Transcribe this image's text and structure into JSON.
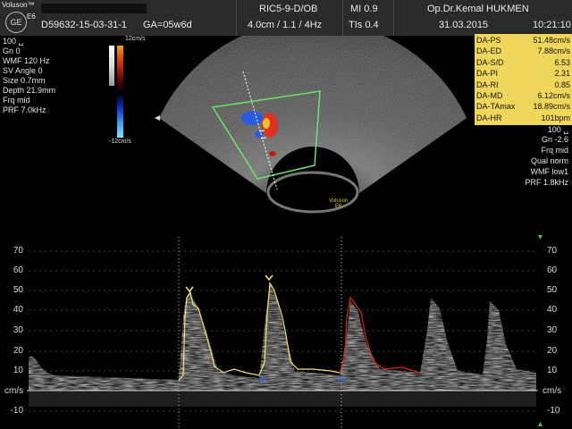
{
  "header": {
    "brand": "Voluson™",
    "model": "E6",
    "logo": "GE",
    "patient_id": "D59632-15-03-31-1",
    "ga": "GA=05w6d",
    "probe": "RIC5-9-D/OB",
    "depth_info": "4.0cm / 1.1 / 4Hz",
    "mi": "MI  0.9",
    "tis": "TIs  0.4",
    "doctor": "Op.Dr.Kemal HUKMEN",
    "date": "31.03.2015",
    "time": "10:21:10"
  },
  "left_params": {
    "power": "100 ␣",
    "gn": "Gn  0",
    "wmf": "WMF 120 Hz",
    "sv_angle": "SV Angle  0",
    "size": "Size  0.7mm",
    "depth": "Depth 21.9mm",
    "frq": "Frq mid",
    "prf": "PRF  7.0kHz"
  },
  "color_bar": {
    "top_label": "12cm/s",
    "bottom_label": "-12cm/s"
  },
  "measurements": [
    {
      "key": "DA-PS",
      "value": "51.48cm/s"
    },
    {
      "key": "DA-ED",
      "value": "7.88cm/s"
    },
    {
      "key": "DA-S/D",
      "value": "6.53"
    },
    {
      "key": "DA-PI",
      "value": "2.31"
    },
    {
      "key": "DA-RI",
      "value": "0.85"
    },
    {
      "key": "DA-MD",
      "value": "6.12cm/s"
    },
    {
      "key": "DA-TAmax",
      "value": "18.89cm/s"
    },
    {
      "key": "DA-HR",
      "value": "101bpm"
    }
  ],
  "right_params": {
    "power": "100 ␣",
    "gn": "Gn -2.6",
    "frq": "Frq mid",
    "qual": "Qual norm",
    "wmf": "WMF low1",
    "prf": "PRF  1.8kHz"
  },
  "watermark": {
    "line1": "Voluson",
    "line2": "E6"
  },
  "doppler_scale": {
    "ticks": [
      "70",
      "60",
      "50",
      "40",
      "30",
      "20",
      "10",
      "-10"
    ],
    "unit": "cm/s"
  },
  "colors": {
    "header_bg": "#2a2a2a",
    "measure_bg": "#eed65a",
    "trace_yellow": "#f5e27a",
    "trace_red": "#d62a1a",
    "sample_box": "#6ee06e"
  }
}
